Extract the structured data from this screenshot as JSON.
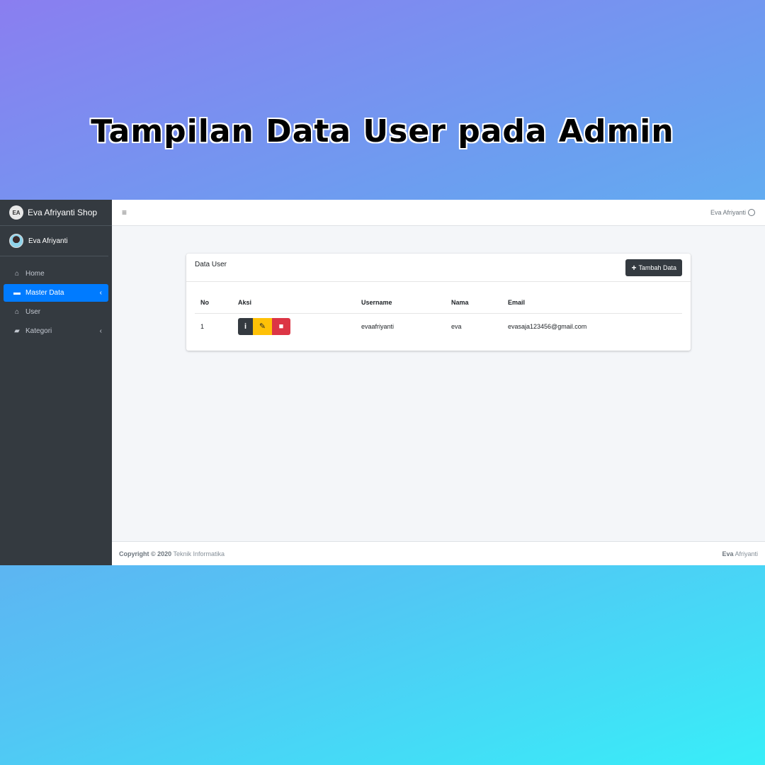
{
  "poster": {
    "title": "Tampilan Data User pada Admin"
  },
  "sidebar": {
    "brand_logo": "EA",
    "brand": "Eva Afriyanti Shop",
    "user_name": "Eva Afriyanti",
    "items": [
      {
        "label": "Home",
        "icon": "home-icon"
      },
      {
        "label": "Master Data",
        "icon": "drive-icon",
        "active": true
      },
      {
        "label": "User",
        "icon": "home-icon"
      },
      {
        "label": "Kategori",
        "icon": "folder-open-icon"
      }
    ]
  },
  "topbar": {
    "user": "Eva Afriyanti"
  },
  "card": {
    "title": "Data User",
    "add_button": "Tambah Data",
    "columns": [
      "No",
      "Aksi",
      "Username",
      "Nama",
      "Email"
    ],
    "rows": [
      {
        "no": "1",
        "username": "evaafriyanti",
        "nama": "eva",
        "email": "evasaja123456@gmail.com"
      }
    ]
  },
  "footer": {
    "copyright_bold": "Copyright © 2020",
    "copyright_text": "Teknik Informatika",
    "right_bold": "Eva",
    "right_text": "Afriyanti"
  },
  "colors": {
    "sidebar": "#343a40",
    "active": "#007bff",
    "info": "#343a40",
    "edit": "#ffc107",
    "delete": "#dc3545"
  }
}
